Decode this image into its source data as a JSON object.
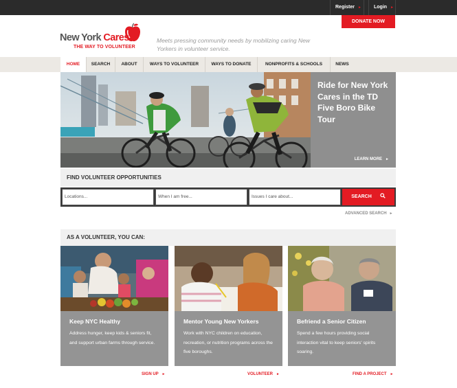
{
  "topbar": {
    "register": "Register",
    "login": "Login",
    "donate": "DONATE NOW"
  },
  "logo": {
    "name_part1": "New York ",
    "name_part2": "Cares",
    "tagline": "THE WAY TO VOLUNTEER"
  },
  "mission": "Meets pressing community needs by mobilizing caring New Yorkers in volunteer service.",
  "nav": {
    "items": [
      {
        "label": "HOME",
        "active": true
      },
      {
        "label": "SEARCH"
      },
      {
        "label": "ABOUT"
      },
      {
        "label": "WAYS TO VOLUNTEER"
      },
      {
        "label": "WAYS TO DONATE"
      },
      {
        "label": "NONPROFITS & SCHOOLS"
      },
      {
        "label": "NEWS"
      }
    ]
  },
  "hero": {
    "title": "Ride for New York Cares in the TD Five Boro Bike Tour",
    "cta": "LEARN MORE"
  },
  "find": {
    "heading": "FIND VOLUNTEER OPPORTUNITIES",
    "location_placeholder": "Locations...",
    "time_placeholder": "When I am free...",
    "issue_placeholder": "Issues I care about...",
    "search_label": "SEARCH",
    "advanced_label": "ADVANCED SEARCH"
  },
  "volunteer": {
    "heading": "AS A VOLUNTEER, YOU CAN:",
    "cards": [
      {
        "title": "Keep NYC Healthy",
        "text": "Address hunger, keep kids & seniors fit, and support urban farms through service.",
        "link": "SIGN UP"
      },
      {
        "title": "Mentor Young New Yorkers",
        "text": "Work with NYC children on education, recreation, or nutrition programs across the five boroughs.",
        "link": "VOLUNTEER"
      },
      {
        "title": "Befriend a Senior Citizen",
        "text": "Spend a few hours providing social interaction vital to keep seniors' spirits soaring.",
        "link": "FIND A PROJECT"
      }
    ]
  },
  "colors": {
    "brand_red": "#e31b23",
    "topbar": "#2b2b2b",
    "nav_bg": "#ece9e4",
    "card_gray": "#949494"
  },
  "icons": {
    "logo": "red-apple-icon",
    "search": "magnifier-icon",
    "arrow": "triangle-right-icon"
  }
}
